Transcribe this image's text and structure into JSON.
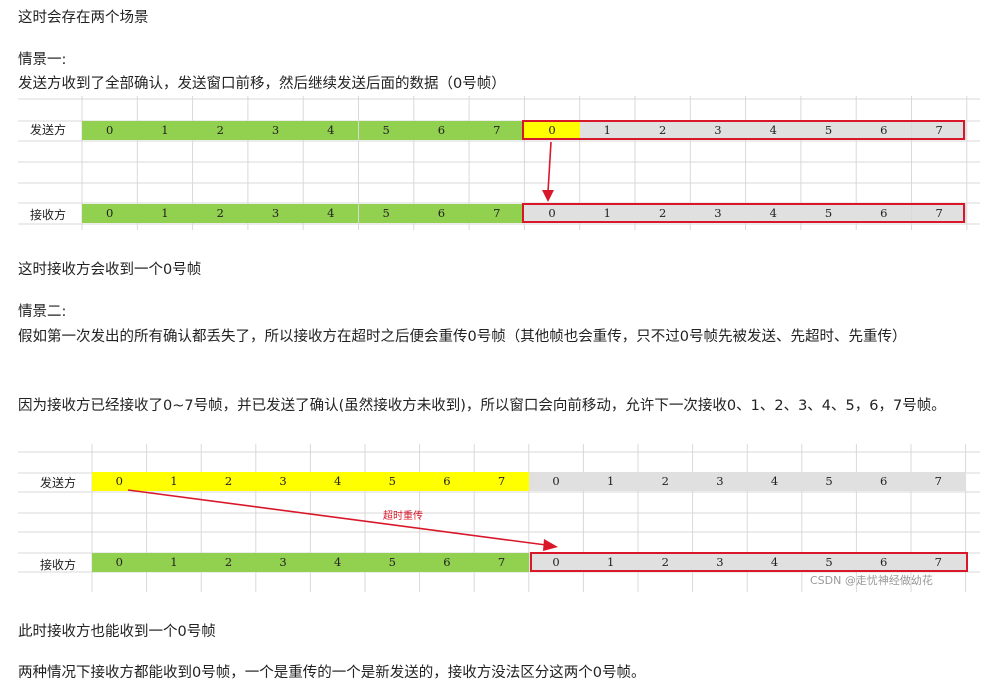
{
  "para1": "这时会存在两个场景",
  "case1_title": "情景一:",
  "case1_desc": "发送方收到了全部确认，发送窗口前移，然后继续发送后面的数据（0号帧）",
  "fig1": {
    "sender_label": "发送方",
    "receiver_label": "接收方",
    "sender_frames": [
      "0",
      "1",
      "2",
      "3",
      "4",
      "5",
      "6",
      "7",
      "0",
      "1",
      "2",
      "3",
      "4",
      "5",
      "6",
      "7"
    ],
    "receiver_frames": [
      "0",
      "1",
      "2",
      "3",
      "4",
      "5",
      "6",
      "7",
      "0",
      "1",
      "2",
      "3",
      "4",
      "5",
      "6",
      "7"
    ]
  },
  "para2": "这时接收方会收到一个0号帧",
  "case2_title": "情景二:",
  "case2_desc": "假如第一次发出的所有确认都丢失了，所以接收方在超时之后便会重传0号帧（其他帧也会重传，只不过0号帧先被发送、先超时、先重传）",
  "case2_desc2": "因为接收方已经接收了0~7号帧，并已发送了确认(虽然接收方未收到)，所以窗口会向前移动，允许下一次接收0、1、2、3、4、5，6，7号帧。",
  "fig2": {
    "sender_label": "发送方",
    "receiver_label": "接收方",
    "sender_frames": [
      "0",
      "1",
      "2",
      "3",
      "4",
      "5",
      "6",
      "7",
      "0",
      "1",
      "2",
      "3",
      "4",
      "5",
      "6",
      "7"
    ],
    "receiver_frames": [
      "0",
      "1",
      "2",
      "3",
      "4",
      "5",
      "6",
      "7",
      "0",
      "1",
      "2",
      "3",
      "4",
      "5",
      "6",
      "7"
    ],
    "arrow_label": "超时重传",
    "watermark": "CSDN @走忧神经做幼花"
  },
  "para3": "此时接收方也能收到一个0号帧",
  "para4": "两种情况下接收方都能收到0号帧，一个是重传的一个是新发送的，接收方没法区分这两个0号帧。",
  "colors": {
    "green": "#92d050",
    "yellow": "#ffff00",
    "gray": "#e0e0e0",
    "red": "#d8182a"
  }
}
